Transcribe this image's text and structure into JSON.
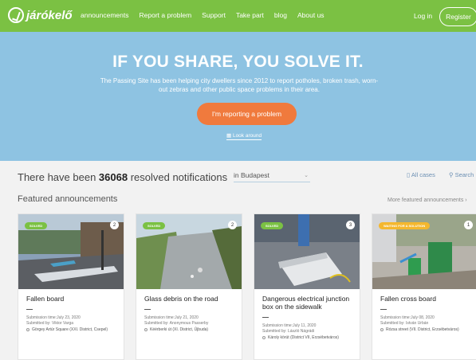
{
  "nav": {
    "logo": "járókelő",
    "links": [
      "announcements",
      "Report a problem",
      "Support",
      "Take part",
      "blog",
      "About us"
    ],
    "login": "Log in",
    "register": "Register"
  },
  "hero": {
    "title": "IF YOU SHARE, YOU SOLVE IT.",
    "subtitle": "The Passing Site has been helping city dwellers since 2012 to report potholes, broken trash, worn-out zebras and other public space problems in their area.",
    "cta": "I'm reporting a problem",
    "look_around": "Look around"
  },
  "stats": {
    "prefix": "There have been",
    "count": "36068",
    "suffix": "resolved notifications",
    "city": "in Budapest",
    "all_cases": "All cases",
    "search": "Search"
  },
  "featured": {
    "heading": "Featured announcements",
    "more": "More featured announcements",
    "cards": [
      {
        "badge": "SOLVED",
        "count": "2",
        "title": "Fallen board",
        "time": "Submission time:July 23, 2020",
        "by": "Submitted by: Viktor Varga",
        "location": "Görgey Artúr Square (XXI. District, Csepel)"
      },
      {
        "badge": "SOLVED",
        "count": "2",
        "title": "Glass debris on the road",
        "time": "Submission time:July 21, 2020",
        "by": "Submitted by: Anonymous Passerby",
        "location": "Kéérberki út (XI. District, Újbuda)"
      },
      {
        "badge": "SOLVED",
        "count": "3",
        "title": "Dangerous electrical junction box on the sidewalk",
        "time": "Submission time:July 11, 2020",
        "by": "Submitted by: László Nágrádi",
        "location": "Károly körút (District VII, Erzsébetváros)"
      },
      {
        "badge": "WAITING FOR A SOLUTION",
        "count": "1",
        "title": "Fallen cross board",
        "time": "Submission time:July 08, 2020",
        "by": "Submitted by: István Urbán",
        "location": "Rózsa street (VII. District, Erzsébetváros)"
      }
    ]
  },
  "colors": {
    "brand_green": "#7bc143",
    "hero_blue": "#8ec3e2",
    "cta_orange": "#f07a3d",
    "waiting_yellow": "#f4b72e"
  }
}
